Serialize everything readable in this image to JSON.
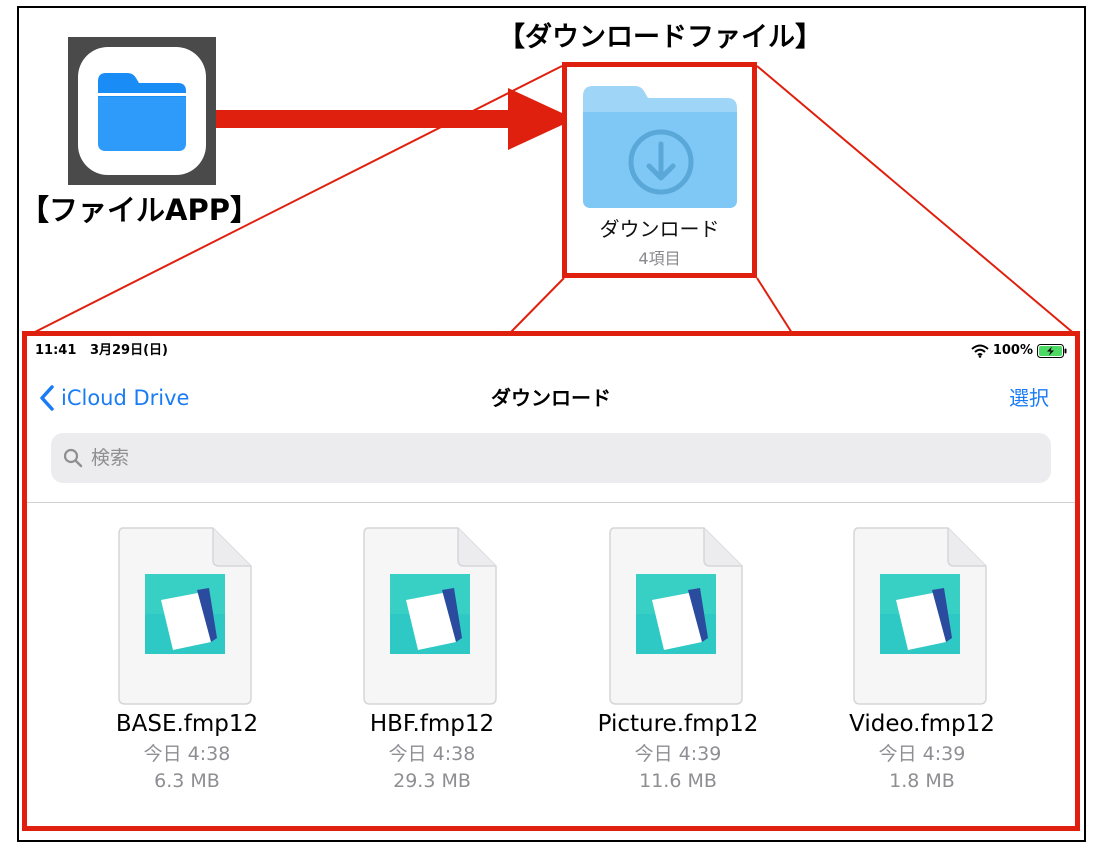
{
  "app_caption": "【ファイルAPP】",
  "folder_callout": {
    "title": "【ダウンロードファイル】",
    "name": "ダウンロード",
    "count": "4項目"
  },
  "screen": {
    "status_bar": {
      "time": "11:41",
      "date": "3月29日(日)",
      "battery": "100%"
    },
    "nav": {
      "back_label": "iCloud Drive",
      "title": "ダウンロード",
      "select_label": "選択"
    },
    "search": {
      "placeholder": "検索",
      "value": ""
    },
    "files": [
      {
        "name": "BASE.fmp12",
        "date": "今日 4:38",
        "size": "6.3 MB"
      },
      {
        "name": "HBF.fmp12",
        "date": "今日 4:38",
        "size": "29.3 MB"
      },
      {
        "name": "Picture.fmp12",
        "date": "今日 4:39",
        "size": "11.6 MB"
      },
      {
        "name": "Video.fmp12",
        "date": "今日 4:39",
        "size": "1.8 MB"
      }
    ]
  },
  "colors": {
    "highlight_red": "#e0200e",
    "ios_blue": "#1a7cf5",
    "folder_blue": "#7fc7f5",
    "battery_green": "#4cd964",
    "filemaker_teal": "#2ec9c4"
  },
  "icons": {
    "app": "files-app-icon",
    "folder": "download-folder-icon",
    "doc": "filemaker-document-icon",
    "back": "chevron-left-icon",
    "search": "magnifier-icon",
    "wifi": "wifi-icon",
    "battery": "battery-charging-icon"
  }
}
